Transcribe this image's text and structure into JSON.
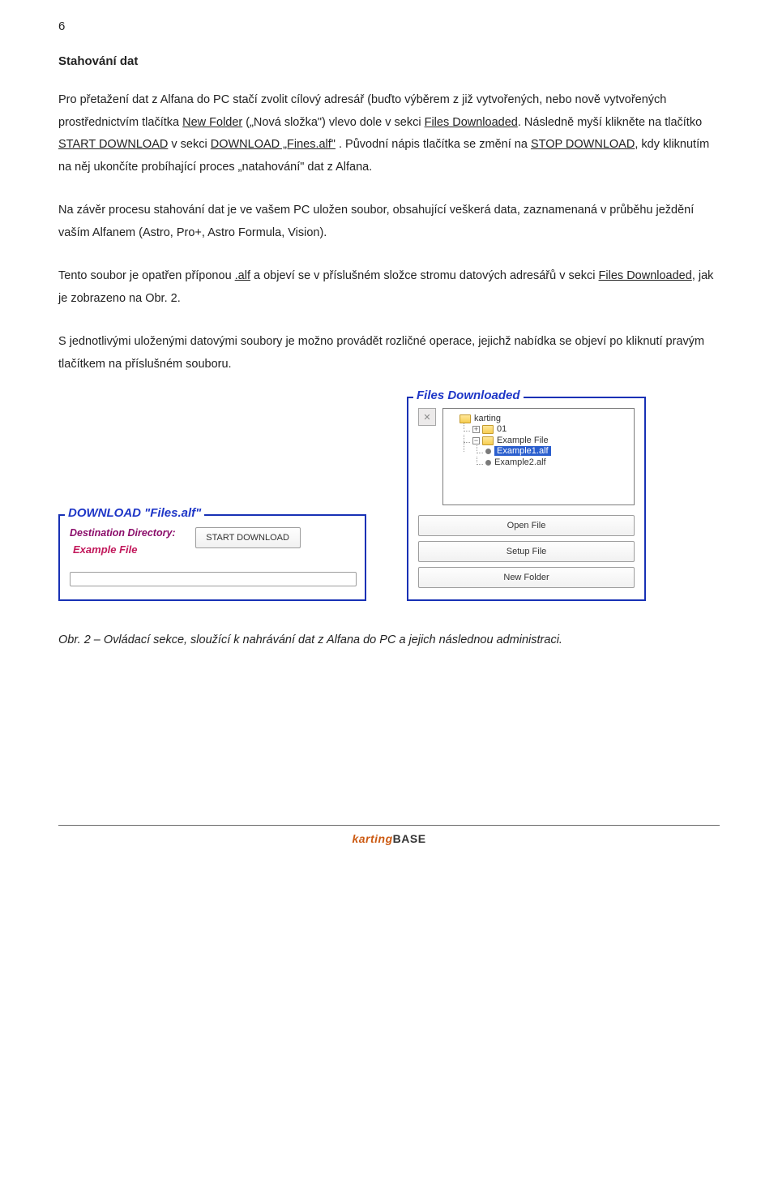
{
  "page_number": "6",
  "section_title": "Stahování dat",
  "paragraphs": {
    "p1a": "Pro přetažení dat z Alfana do PC stačí zvolit cílový adresář (buďto výběrem z již vytvořených, nebo nově vytvořených prostřednictvím tlačítka ",
    "p1_newfolder": "New Folder",
    "p1b": " („Nová složka\") vlevo dole v sekci ",
    "p1_files": "Files Downloaded",
    "p1c": ". Následně myší klikněte na tlačítko ",
    "p1_start": "START DOWNLOAD",
    "p1d": " v sekci ",
    "p1_dlfines": "DOWNLOAD „Fines.alf\"",
    "p1e": " . Původní nápis tlačítka se změní na ",
    "p1_stop": "STOP DOWNLOAD",
    "p1f": ", kdy kliknutím na něj ukončíte probíhající proces „natahování\" dat z Alfana.",
    "p2": "Na závěr procesu stahování dat je ve vašem PC uložen soubor, obsahující veškerá data, zaznamenaná v průběhu ježdění vaším Alfanem (Astro, Pro+, Astro Formula, Vision).",
    "p3a": "Tento soubor je opatřen příponou ",
    "p3_ext": ".alf",
    "p3b": "  a objeví se v příslušném složce stromu datových adresářů v sekci ",
    "p3_files": "Files Downloaded",
    "p3c": ", jak je zobrazeno na Obr. 2.",
    "p4": "S jednotlivými uloženými datovými soubory je možno provádět rozličné operace, jejichž nabídka se objeví po kliknutí pravým tlačítkem na příslušném souboru."
  },
  "download_panel": {
    "title": "DOWNLOAD \"Files.alf\"",
    "dest_label": "Destination Directory:",
    "dest_value": "Example File",
    "start_btn": "START DOWNLOAD"
  },
  "files_panel": {
    "title": "Files Downloaded",
    "tree": {
      "root": "karting",
      "sub": "01",
      "subsub": "Example File",
      "leaf1": "Example1.alf",
      "leaf2": "Example2.alf"
    },
    "buttons": {
      "open": "Open File",
      "setup": "Setup File",
      "newfolder": "New Folder"
    }
  },
  "caption": "Obr. 2 – Ovládací sekce, sloužící k nahrávání dat z Alfana do PC a jejich následnou administraci.",
  "footer": {
    "a": "karting",
    "b": "BASE"
  }
}
